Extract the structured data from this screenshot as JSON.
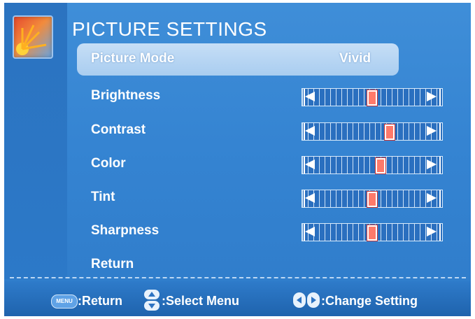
{
  "osd": {
    "title": "PICTURE SETTINGS",
    "logo_icon": "picture-settings-icon",
    "selected_row_color": "#b9d7f4",
    "background_color": "#3a88d4",
    "rows": [
      {
        "label": "Picture Mode",
        "value": "Vivid",
        "selected": true
      },
      {
        "label": "Brightness",
        "slider_fraction": 0.5
      },
      {
        "label": "Contrast",
        "slider_fraction": 0.66
      },
      {
        "label": "Color",
        "slider_fraction": 0.58
      },
      {
        "label": "Tint",
        "slider_fraction": 0.5
      },
      {
        "label": "Sharpness",
        "slider_fraction": 0.5
      },
      {
        "label": "Return"
      }
    ]
  },
  "footer": {
    "menu_key_label": "MENU",
    "return_hint": ":Return",
    "select_hint": ":Select Menu",
    "change_hint": ":Change Setting",
    "icons": [
      "menu-key-icon",
      "up-down-icon",
      "left-right-icon"
    ]
  }
}
